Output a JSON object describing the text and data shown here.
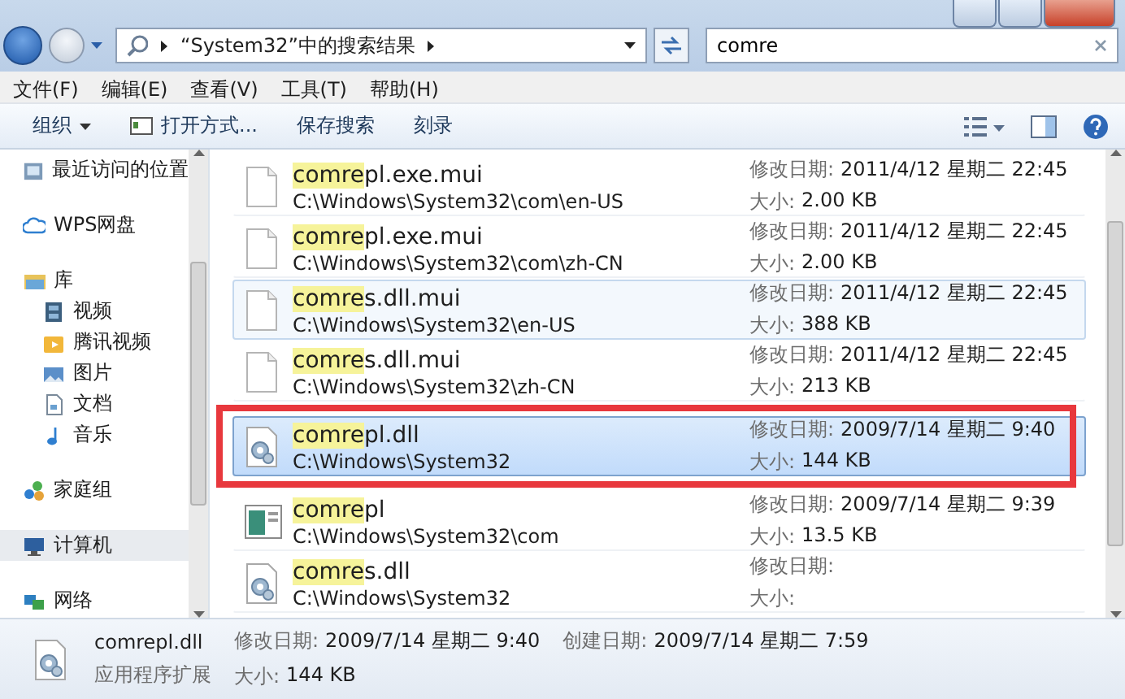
{
  "address": {
    "location": "“System32”中的搜索结果"
  },
  "search": {
    "value": "comre"
  },
  "menu": [
    "文件(F)",
    "编辑(E)",
    "查看(V)",
    "工具(T)",
    "帮助(H)"
  ],
  "toolbar": [
    {
      "label": "组织",
      "kind": "dropdown"
    },
    {
      "label": "打开方式...",
      "kind": "open"
    },
    {
      "label": "保存搜索",
      "kind": "plain"
    },
    {
      "label": "刻录",
      "kind": "plain"
    }
  ],
  "sidebar": {
    "items": [
      {
        "label": "最近访问的位置",
        "kind": "recent",
        "selected": false
      },
      {
        "label": "WPS网盘",
        "kind": "cloud",
        "selected": false
      },
      {
        "label": "库",
        "kind": "library",
        "selected": false,
        "children": [
          {
            "label": "视频",
            "kind": "video",
            "selected": false
          },
          {
            "label": "腾讯视频",
            "kind": "folder",
            "selected": false
          },
          {
            "label": "图片",
            "kind": "pictures",
            "selected": false
          },
          {
            "label": "文档",
            "kind": "documents",
            "selected": false
          },
          {
            "label": "音乐",
            "kind": "music",
            "selected": false
          }
        ]
      },
      {
        "label": "家庭组",
        "kind": "homegroup",
        "selected": false
      },
      {
        "label": "计算机",
        "kind": "computer",
        "selected": true
      },
      {
        "label": "网络",
        "kind": "network",
        "selected": false
      }
    ]
  },
  "results": [
    {
      "match": "comre",
      "rest": "pl.exe.mui",
      "path": "C:\\Windows\\System32\\com\\en-US",
      "date_label": "修改日期:",
      "date": "2011/4/12 星期二 22:45",
      "size_label": "大小:",
      "size": "2.00 KB",
      "kind": "blank",
      "selected": false,
      "hovered": false,
      "highlighted": false
    },
    {
      "match": "comre",
      "rest": "pl.exe.mui",
      "path": "C:\\Windows\\System32\\com\\zh-CN",
      "date_label": "修改日期:",
      "date": "2011/4/12 星期二 22:45",
      "size_label": "大小:",
      "size": "2.00 KB",
      "kind": "blank",
      "selected": false,
      "hovered": false,
      "highlighted": false
    },
    {
      "match": "comre",
      "rest": "s.dll.mui",
      "path": "C:\\Windows\\System32\\en-US",
      "date_label": "修改日期:",
      "date": "2011/4/12 星期二 22:45",
      "size_label": "大小:",
      "size": "388 KB",
      "kind": "blank",
      "selected": false,
      "hovered": true,
      "highlighted": false
    },
    {
      "match": "comre",
      "rest": "s.dll.mui",
      "path": "C:\\Windows\\System32\\zh-CN",
      "date_label": "修改日期:",
      "date": "2011/4/12 星期二 22:45",
      "size_label": "大小:",
      "size": "213 KB",
      "kind": "blank",
      "selected": false,
      "hovered": false,
      "highlighted": false
    },
    {
      "match": "comre",
      "rest": "pl.dll",
      "path": "C:\\Windows\\System32",
      "date_label": "修改日期:",
      "date": "2009/7/14 星期二 9:40",
      "size_label": "大小:",
      "size": "144 KB",
      "kind": "gear",
      "selected": true,
      "hovered": false,
      "highlighted": true
    },
    {
      "match": "comre",
      "rest": "pl",
      "path": "C:\\Windows\\System32\\com",
      "date_label": "修改日期:",
      "date": "2009/7/14 星期二 9:39",
      "size_label": "大小:",
      "size": "13.5 KB",
      "kind": "console",
      "selected": false,
      "hovered": false,
      "highlighted": false
    },
    {
      "match": "comre",
      "rest": "s.dll",
      "path": "C:\\Windows\\System32",
      "date_label": "修改日期:",
      "size_label": "大小:",
      "kind": "gear",
      "selected": false,
      "hovered": false,
      "highlighted": false
    }
  ],
  "details": {
    "name": "comrepl.dll",
    "type": "应用程序扩展",
    "fields": [
      {
        "label": "修改日期:",
        "value": "2009/7/14 星期二 9:40"
      },
      {
        "label": "创建日期:",
        "value": "2009/7/14 星期二 7:59"
      },
      {
        "label": "大小:",
        "value": "144 KB"
      }
    ]
  }
}
